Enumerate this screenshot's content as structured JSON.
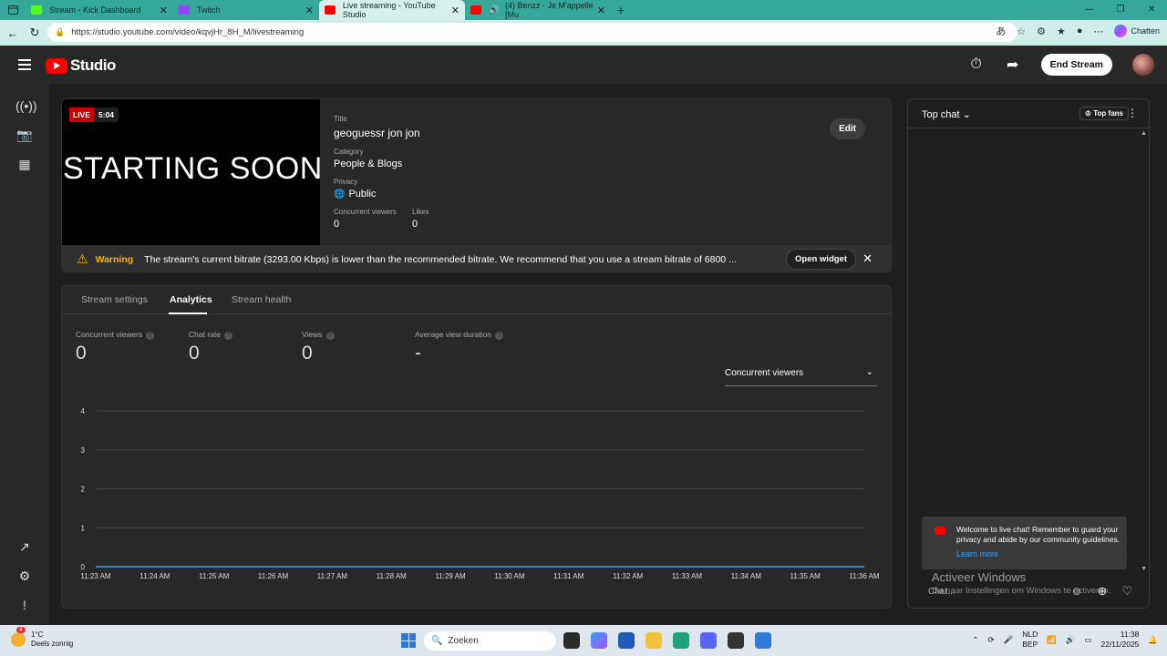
{
  "browser": {
    "tabs": [
      {
        "label": "Stream - Kick Dashboard",
        "color": "#53fc18"
      },
      {
        "label": "Twitch",
        "color": "#9146ff"
      },
      {
        "label": "Live streaming - YouTube Studio",
        "color": "#ff0000"
      },
      {
        "label": "(4) Benzz - Je M'appelle [Mu",
        "color": "#ff0000"
      }
    ],
    "url": "https://studio.youtube.com/video/kqvjHr_8H_M/livestreaming",
    "chatten_label": "Chatten"
  },
  "header": {
    "logo_text": "Studio",
    "end_stream_label": "End Stream"
  },
  "stream": {
    "live_label": "LIVE",
    "elapsed": "5:04",
    "thumbnail_text": "STARTING SOON",
    "title_label": "Title",
    "title": "geoguessr jon jon",
    "category_label": "Category",
    "category": "People & Blogs",
    "privacy_label": "Privacy",
    "privacy": "Public",
    "concurrent_label": "Concurrent viewers",
    "concurrent": "0",
    "likes_label": "Likes",
    "likes": "0",
    "edit_label": "Edit"
  },
  "warning": {
    "label": "Warning",
    "message": "The stream's current bitrate (3293.00 Kbps) is lower than the recommended bitrate. We recommend that you use a stream bitrate of 6800 ...",
    "open_widget_label": "Open widget"
  },
  "analytics": {
    "tabs": [
      "Stream settings",
      "Analytics",
      "Stream health"
    ],
    "stats": [
      {
        "label": "Concurrent viewers",
        "value": "0"
      },
      {
        "label": "Chat rate",
        "value": "0"
      },
      {
        "label": "Views",
        "value": "0"
      },
      {
        "label": "Average view duration",
        "value": "-"
      }
    ],
    "metric_select": "Concurrent viewers"
  },
  "chart_data": {
    "type": "line",
    "x": [
      "11:23 AM",
      "11:24 AM",
      "11:25 AM",
      "11:26 AM",
      "11:27 AM",
      "11:28 AM",
      "11:29 AM",
      "11:30 AM",
      "11:31 AM",
      "11:32 AM",
      "11:33 AM",
      "11:34 AM",
      "11:35 AM",
      "11:36 AM"
    ],
    "series": [
      {
        "values": [
          0,
          0,
          0,
          0,
          0,
          0,
          0,
          0,
          0,
          0,
          0,
          0,
          0,
          0
        ],
        "color": "#3ea6ff"
      }
    ],
    "yticks": [
      "0",
      "1",
      "2",
      "3",
      "4"
    ],
    "ylim": [
      0,
      4
    ],
    "grid": true
  },
  "chat": {
    "mode_label": "Top chat",
    "top_fans_label": "Top fans",
    "welcome_text": "Welcome to live chat! Remember to guard your privacy and abide by our community guidelines.",
    "learn_more": "Learn more",
    "input_placeholder": "Chat..."
  },
  "os": {
    "activate_title": "Activeer Windows",
    "activate_sub": "Ga naar Instellingen om Windows te activeren.",
    "temp": "1°C",
    "weather": "Deels zonnig",
    "weather_badge": "4",
    "search_placeholder": "Zoeken",
    "lang1": "NLD",
    "lang2": "BEP",
    "time": "11:38",
    "date": "22/11/2025"
  }
}
